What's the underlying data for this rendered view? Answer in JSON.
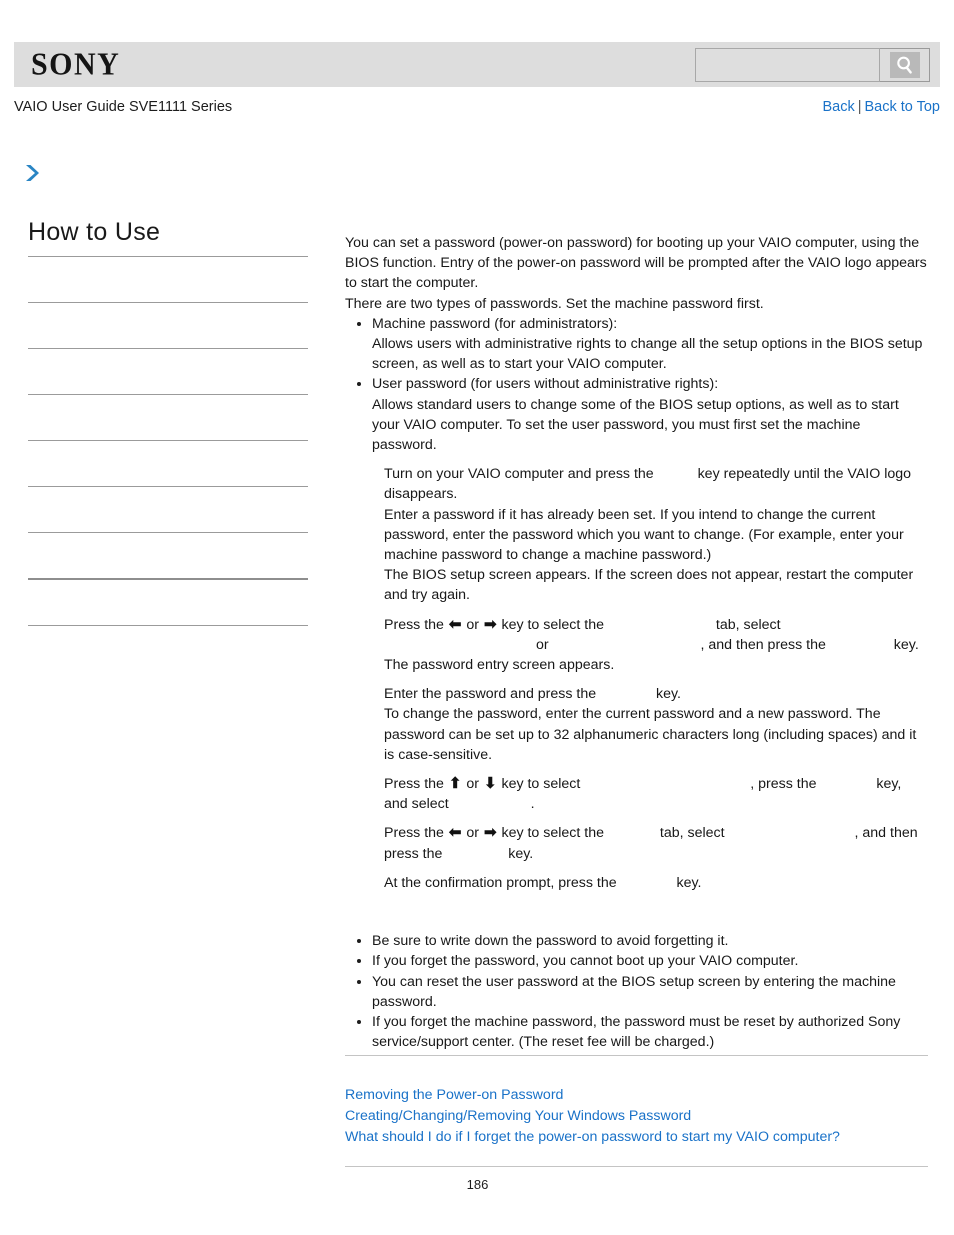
{
  "header": {
    "logo": "SONY",
    "search": {
      "value": "",
      "placeholder": "",
      "icon": "search-icon"
    }
  },
  "subheader": {
    "guide_title": "VAIO User Guide SVE1111 Series",
    "back_label": "Back",
    "separator": "|",
    "back_to_top_label": "Back to Top"
  },
  "breadcrumb": {
    "icon": "chevron-right-icon",
    "accent_color": "#2a85c4",
    "label": ""
  },
  "sidebar": {
    "title": "How to Use",
    "items": [
      {
        "label": ""
      },
      {
        "label": ""
      },
      {
        "label": ""
      },
      {
        "label": ""
      },
      {
        "label": ""
      },
      {
        "label": ""
      },
      {
        "label": ""
      },
      {
        "label": ""
      },
      {
        "label": ""
      }
    ]
  },
  "content": {
    "intro": [
      "You can set a password (power-on password) for booting up your VAIO computer, using the BIOS function. Entry of the power-on password will be prompted after the VAIO logo appears to start the computer.",
      "There are two types of passwords. Set the machine password first."
    ],
    "password_types": [
      {
        "title": "Machine password (for administrators):",
        "body": "Allows users with administrative rights to change all the setup options in the BIOS setup screen, as well as to start your VAIO computer."
      },
      {
        "title": "User password (for users without administrative rights):",
        "body": "Allows standard users to change some of the BIOS setup options, as well as to start your VAIO computer. To set the user password, you must first set the machine password."
      }
    ],
    "steps": [
      {
        "parts": [
          "Turn on your VAIO computer and press the ",
          " key repeatedly until the VAIO logo disappears."
        ],
        "note": "Enter a password if it has already been set. If you intend to change the current password, enter the password which you want to change. (For example, enter your machine password to change a machine password.)",
        "note2": "The BIOS setup screen appears. If the screen does not appear, restart the computer and try again."
      },
      {
        "parts": [
          "Press the ",
          " or ",
          " key to select the ",
          " tab, select ",
          " or ",
          ", and then press the ",
          " key."
        ],
        "note": "The password entry screen appears."
      },
      {
        "parts": [
          "Enter the password and press the ",
          " key."
        ],
        "note": "To change the password, enter the current password and a new password. The password can be set up to 32 alphanumeric characters long (including spaces) and it is case-sensitive."
      },
      {
        "parts": [
          "Press the ",
          " or ",
          " key to select ",
          ", press the ",
          " key, and select ",
          "."
        ]
      },
      {
        "parts": [
          "Press the ",
          " or ",
          " key to select the ",
          " tab, select ",
          ", and then press the ",
          " key."
        ]
      },
      {
        "parts": [
          "At the confirmation prompt, press the ",
          " key."
        ]
      }
    ],
    "notes": [
      "Be sure to write down the password to avoid forgetting it.",
      "If you forget the password, you cannot boot up your VAIO computer.",
      "You can reset the user password at the BIOS setup screen by entering the machine password.",
      "If you forget the machine password, the password must be reset by authorized Sony service/support center. (The reset fee will be charged.)"
    ]
  },
  "related_links": [
    "Removing the Power-on Password",
    "Creating/Changing/Removing Your Windows Password",
    "What should I do if I forget the power-on password to start my VAIO computer?"
  ],
  "footer": {
    "page_number": "186"
  }
}
